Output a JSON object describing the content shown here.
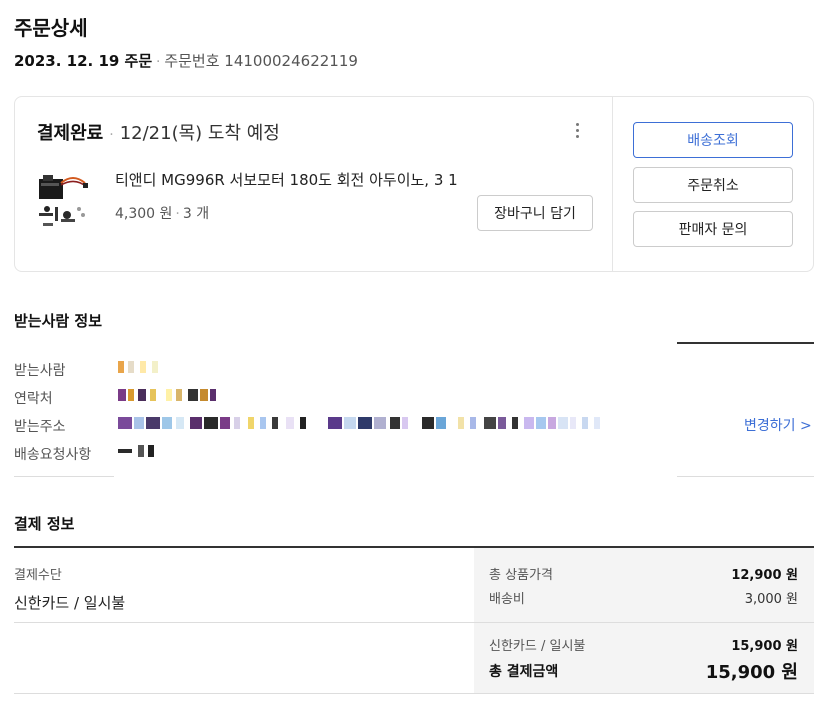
{
  "page": {
    "title": "주문상세",
    "order_date": "2023. 12. 19 주문",
    "order_number_label": "주문번호",
    "order_number": "14100024622119"
  },
  "order_card": {
    "status": "결제완료",
    "arrival": "12/21(목) 도착 예정",
    "product_name": "티앤디 MG996R 서보모터 180도 회전 아두이노, 3 1",
    "price": "4,300 원",
    "quantity": "3 개",
    "cart_button": "장바구니 담기",
    "actions": {
      "track": "배송조회",
      "cancel": "주문취소",
      "inquiry": "판매자 문의"
    }
  },
  "recipient": {
    "title": "받는사람 정보",
    "name_label": "받는사람",
    "phone_label": "연락처",
    "address_label": "받는주소",
    "request_label": "배송요청사항",
    "change_link": "변경하기 >"
  },
  "payment": {
    "title": "결제 정보",
    "method_label": "결제수단",
    "method_value": "신한카드 / 일시불",
    "product_total_label": "총 상품가격",
    "product_total": "12,900 원",
    "shipping_label": "배송비",
    "shipping": "3,000 원",
    "card_label": "신한카드 / 일시불",
    "card_amount": "15,900 원",
    "grand_total_label": "총 결제금액",
    "grand_total": "15,900 원"
  },
  "colors": {
    "accent": "#3d6fd6"
  }
}
